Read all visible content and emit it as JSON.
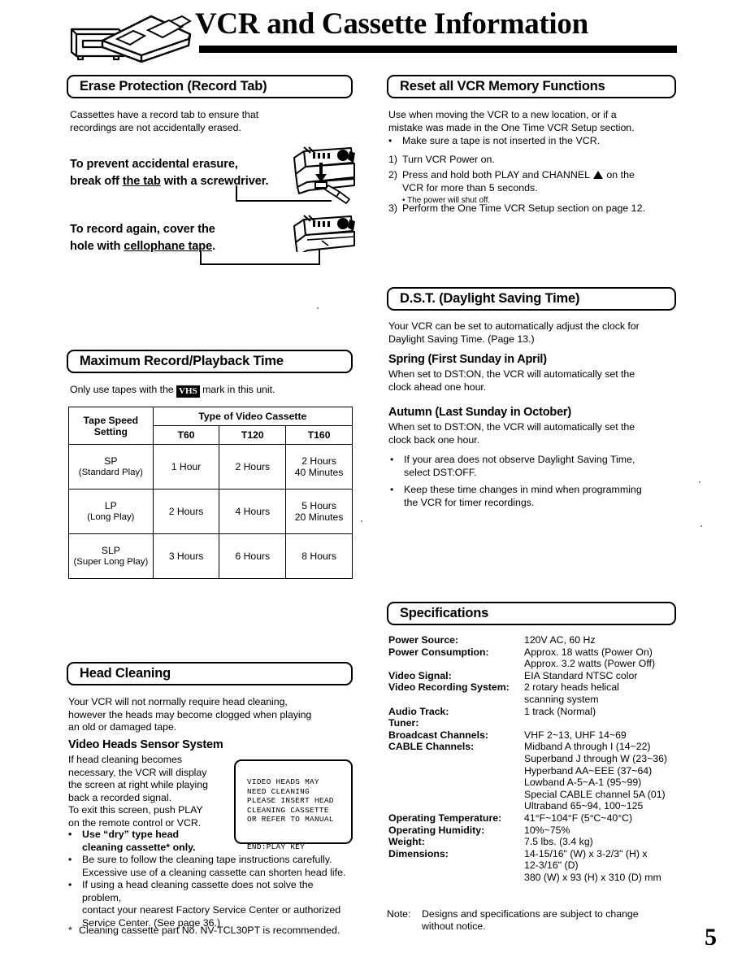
{
  "header": {
    "title": "VCR and Cassette Information",
    "illustration": "vcr-with-cassette-illustration"
  },
  "page_number": "5",
  "left_column": {
    "erase_protection": {
      "heading": "Erase Protection (Record Tab)",
      "intro": [
        "Cassettes have a record tab to ensure that",
        "recordings are not accidentally erased."
      ],
      "instruction_1": {
        "line1": "To prevent accidental erasure,",
        "line2_pre": "break off ",
        "line2_underline": "the tab",
        "line2_post": " with a screwdriver."
      },
      "instruction_2": {
        "line1": "To record again, cover the",
        "line2_pre": "hole with ",
        "line2_underline": "cellophane tape",
        "line2_post": "."
      }
    },
    "max_record_time": {
      "heading": "Maximum Record/Playback Time",
      "note_pre": "Only use tapes with the ",
      "note_mark": "VHS",
      "note_post": " mark in this unit."
    },
    "head_cleaning": {
      "heading": "Head Cleaning",
      "intro": [
        "Your VCR will not normally require head cleaning,",
        "however the heads may become clogged when playing",
        "an old or damaged tape."
      ],
      "sub_heading": "Video Heads Sensor System",
      "sub_body": [
        "If head cleaning becomes",
        "necessary, the VCR will display",
        "the screen at right while playing",
        "back a recorded signal.",
        "To exit this screen, push PLAY",
        "on the remote control or VCR."
      ],
      "tv_screen": {
        "lines": [
          "VIDEO HEADS MAY",
          "NEED CLEANING",
          "PLEASE INSERT HEAD",
          "CLEANING CASSETTE",
          "OR REFER TO MANUAL"
        ],
        "end_line": "END:PLAY KEY"
      },
      "bullets": [
        {
          "marker": "•",
          "bold": true,
          "lines": [
            "Use “dry” type head",
            "cleaning cassette* only."
          ]
        },
        {
          "marker": "•",
          "bold": false,
          "lines": [
            "Be sure to follow the cleaning tape instructions carefully.",
            "Excessive use of a cleaning cassette can shorten head life."
          ]
        },
        {
          "marker": "•",
          "bold": false,
          "lines": [
            "If using a head cleaning cassette does not solve the problem,",
            "contact your nearest Factory Service Center or authorized",
            "Service Center. (See page 36.)"
          ]
        }
      ],
      "footnote": {
        "marker": "*",
        "text": "Cleaning cassette part No. NV-TCL30PT is recommended."
      }
    }
  },
  "right_column": {
    "reset_memory": {
      "heading": "Reset all VCR Memory Functions",
      "intro": [
        "Use when moving the VCR to a new location, or if a",
        "mistake was made in the One Time VCR Setup section."
      ],
      "bullet": {
        "marker": "•",
        "text": "Make sure a tape is not inserted in the VCR."
      },
      "steps": [
        {
          "marker": "1)",
          "lines": [
            "Turn VCR Power on."
          ]
        },
        {
          "marker": "2)",
          "lines_pre": "Press and hold both PLAY and CHANNEL ",
          "lines_icon": "up-triangle",
          "lines_post": " on the",
          "line2": "VCR for more than 5 seconds.",
          "subnote": "• The power will shut off."
        },
        {
          "marker": "3)",
          "lines": [
            "Perform the One Time VCR Setup section on page 12."
          ]
        }
      ]
    },
    "dst": {
      "heading": "D.S.T. (Daylight Saving Time)",
      "intro": [
        "Your VCR can be set to automatically adjust the clock for",
        "Daylight Saving Time. (Page 13.)"
      ],
      "spring": {
        "title": "Spring (First Sunday in April)",
        "body": [
          "When set to DST:ON, the VCR will automatically set the",
          "clock ahead one hour."
        ]
      },
      "autumn": {
        "title": "Autumn (Last Sunday in October)",
        "body": [
          "When set to DST:ON, the VCR will automatically set the",
          "clock back one hour."
        ]
      },
      "bullets": [
        {
          "marker": "•",
          "lines": [
            "If your area does not observe Daylight Saving Time,",
            "select DST:OFF."
          ]
        },
        {
          "marker": "•",
          "lines": [
            "Keep these time changes in mind when programming",
            "the VCR for timer recordings."
          ]
        }
      ]
    },
    "specifications": {
      "heading": "Specifications",
      "rows": [
        {
          "key": "Power Source:",
          "value": "120V AC, 60 Hz"
        },
        {
          "key": "Power Consumption:",
          "value": "Approx. 18 watts (Power On)"
        },
        {
          "key": "",
          "value": "Approx. 3.2 watts (Power Off)"
        },
        {
          "key": "Video Signal:",
          "value": "EIA Standard NTSC color"
        },
        {
          "key": "Video Recording System:",
          "value": "2 rotary heads helical"
        },
        {
          "key": "",
          "value": "scanning system"
        },
        {
          "key": "Audio Track:",
          "value": "1 track (Normal)"
        },
        {
          "key": "Tuner:",
          "value": ""
        },
        {
          "key": "Broadcast Channels:",
          "value": "VHF 2~13, UHF 14~69"
        },
        {
          "key": "CABLE Channels:",
          "value": "Midband A through I (14~22)"
        },
        {
          "key": "",
          "value": "Superband J through W (23~36)"
        },
        {
          "key": "",
          "value": "Hyperband AA~EEE (37~64)"
        },
        {
          "key": "",
          "value": "Lowband A-5~A-1 (95~99)"
        },
        {
          "key": "",
          "value": "Special CABLE channel 5A (01)"
        },
        {
          "key": "",
          "value": "Ultraband 65~94, 100~125"
        },
        {
          "key": "Operating Temperature:",
          "value": "41°F~104°F (5°C~40°C)"
        },
        {
          "key": "Operating Humidity:",
          "value": "10%~75%"
        },
        {
          "key": "Weight:",
          "value": "7.5 lbs. (3.4 kg)"
        },
        {
          "key": "Dimensions:",
          "value": "14-15/16\" (W) x 3-2/3\" (H) x"
        },
        {
          "key": "",
          "value": "12-3/16\" (D)"
        },
        {
          "key": "",
          "value": "380 (W) x 93 (H) x 310 (D) mm"
        }
      ],
      "note": {
        "label": "Note:",
        "lines": [
          "Designs and specifications are subject to change",
          "without notice."
        ]
      }
    }
  },
  "table_data": {
    "type": "table",
    "title": "Maximum Record/Playback Time",
    "col_group_header": "Type of Video Cassette",
    "row_header": "Tape Speed Setting",
    "row_header_line1": "Tape Speed",
    "row_header_line2": "Setting",
    "columns": [
      "T60",
      "T120",
      "T160"
    ],
    "rows": [
      {
        "speed": "SP",
        "speed_full": "(Standard Play)",
        "values": [
          "1 Hour",
          "2 Hours",
          "2 Hours 40 Minutes"
        ],
        "values_split": [
          [
            "1 Hour"
          ],
          [
            "2 Hours"
          ],
          [
            "2 Hours",
            "40 Minutes"
          ]
        ]
      },
      {
        "speed": "LP",
        "speed_full": "(Long Play)",
        "values": [
          "2 Hours",
          "4 Hours",
          "5 Hours 20 Minutes"
        ],
        "values_split": [
          [
            "2 Hours"
          ],
          [
            "4 Hours"
          ],
          [
            "5 Hours",
            "20 Minutes"
          ]
        ]
      },
      {
        "speed": "SLP",
        "speed_full": "(Super Long Play)",
        "values": [
          "3 Hours",
          "6 Hours",
          "8 Hours"
        ],
        "values_split": [
          [
            "3 Hours"
          ],
          [
            "6 Hours"
          ],
          [
            "8 Hours"
          ]
        ]
      }
    ]
  },
  "colors": {
    "ink": "#000000",
    "paper": "#ffffff"
  }
}
